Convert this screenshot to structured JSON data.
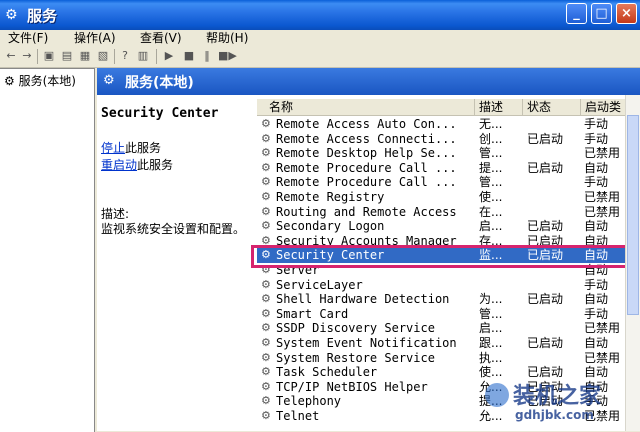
{
  "window": {
    "title": "服务",
    "minimize": "_",
    "maximize": "□",
    "close": "×"
  },
  "menu": [
    "文件(F)",
    "操作(A)",
    "查看(V)",
    "帮助(H)"
  ],
  "tree": {
    "root": "服务(本地)"
  },
  "pane": {
    "title": "服务(本地)"
  },
  "desc": {
    "service_name": "Security Center",
    "stop_link": "停止",
    "stop_rest": "此服务",
    "restart_link": "重启动",
    "restart_rest": "此服务",
    "label": "描述:",
    "text": "监视系统安全设置和配置。"
  },
  "columns": [
    "名称",
    "描述",
    "状态",
    "启动类"
  ],
  "rows": [
    {
      "name": "Remote Access Auto Con...",
      "desc": "无...",
      "status": "",
      "startup": "手动"
    },
    {
      "name": "Remote Access Connecti...",
      "desc": "创...",
      "status": "已启动",
      "startup": "手动"
    },
    {
      "name": "Remote Desktop Help Se...",
      "desc": "管...",
      "status": "",
      "startup": "已禁用"
    },
    {
      "name": "Remote Procedure Call ...",
      "desc": "提...",
      "status": "已启动",
      "startup": "自动"
    },
    {
      "name": "Remote Procedure Call ...",
      "desc": "管...",
      "status": "",
      "startup": "手动"
    },
    {
      "name": "Remote Registry",
      "desc": "使...",
      "status": "",
      "startup": "已禁用"
    },
    {
      "name": "Routing and Remote Access",
      "desc": "在...",
      "status": "",
      "startup": "已禁用"
    },
    {
      "name": "Secondary Logon",
      "desc": "启...",
      "status": "已启动",
      "startup": "自动"
    },
    {
      "name": "Security Accounts Manager",
      "desc": "存...",
      "status": "已启动",
      "startup": "自动"
    },
    {
      "name": "Security Center",
      "desc": "监...",
      "status": "已启动",
      "startup": "自动"
    },
    {
      "name": "Server",
      "desc": "",
      "status": "",
      "startup": "自动"
    },
    {
      "name": "ServiceLayer",
      "desc": "",
      "status": "",
      "startup": "手动"
    },
    {
      "name": "Shell Hardware Detection",
      "desc": "为...",
      "status": "已启动",
      "startup": "自动"
    },
    {
      "name": "Smart Card",
      "desc": "管...",
      "status": "",
      "startup": "手动"
    },
    {
      "name": "SSDP Discovery Service",
      "desc": "启...",
      "status": "",
      "startup": "已禁用"
    },
    {
      "name": "System Event Notification",
      "desc": "跟...",
      "status": "已启动",
      "startup": "自动"
    },
    {
      "name": "System Restore Service",
      "desc": "执...",
      "status": "",
      "startup": "已禁用"
    },
    {
      "name": "Task Scheduler",
      "desc": "使...",
      "status": "已启动",
      "startup": "自动"
    },
    {
      "name": "TCP/IP NetBIOS Helper",
      "desc": "允...",
      "status": "已启动",
      "startup": "自动"
    },
    {
      "name": "Telephony",
      "desc": "提...",
      "status": "已启动",
      "startup": "手动"
    },
    {
      "name": "Telnet",
      "desc": "允...",
      "status": "",
      "startup": "已禁用"
    }
  ],
  "selected_row": 9,
  "watermark": {
    "text": "装机之家",
    "url": "gdhjbk.com"
  }
}
